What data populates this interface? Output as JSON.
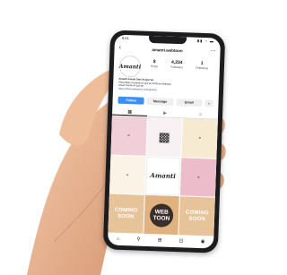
{
  "status": {
    "time": "9:41",
    "icons": "▮▮ ◔ ▬"
  },
  "profile": {
    "username": "amanti.webtoon",
    "avatar_text": "Amanti",
    "stats": [
      {
        "num": "8",
        "label": "Posts"
      },
      {
        "num": "4,234",
        "label": "Followers"
      },
      {
        "num": "1",
        "label": "Following"
      }
    ],
    "bio_lines": [
      "Amanti Komik Seni Al-Qur'an",
      "Penerbitan Kembali Al-Qur'an bil Bunyi Bahasa",
      "Asian Komik Al-Qur'an",
      "https://www.webtoons.com/amanti"
    ]
  },
  "actions": {
    "follow": "Follow",
    "message": "Message",
    "email": "Email",
    "more": "⌄"
  },
  "grid": {
    "soon_text": "COMING SOON",
    "web_line1": "WEB",
    "web_line2": "TOON",
    "logo_text": "Amanti"
  }
}
